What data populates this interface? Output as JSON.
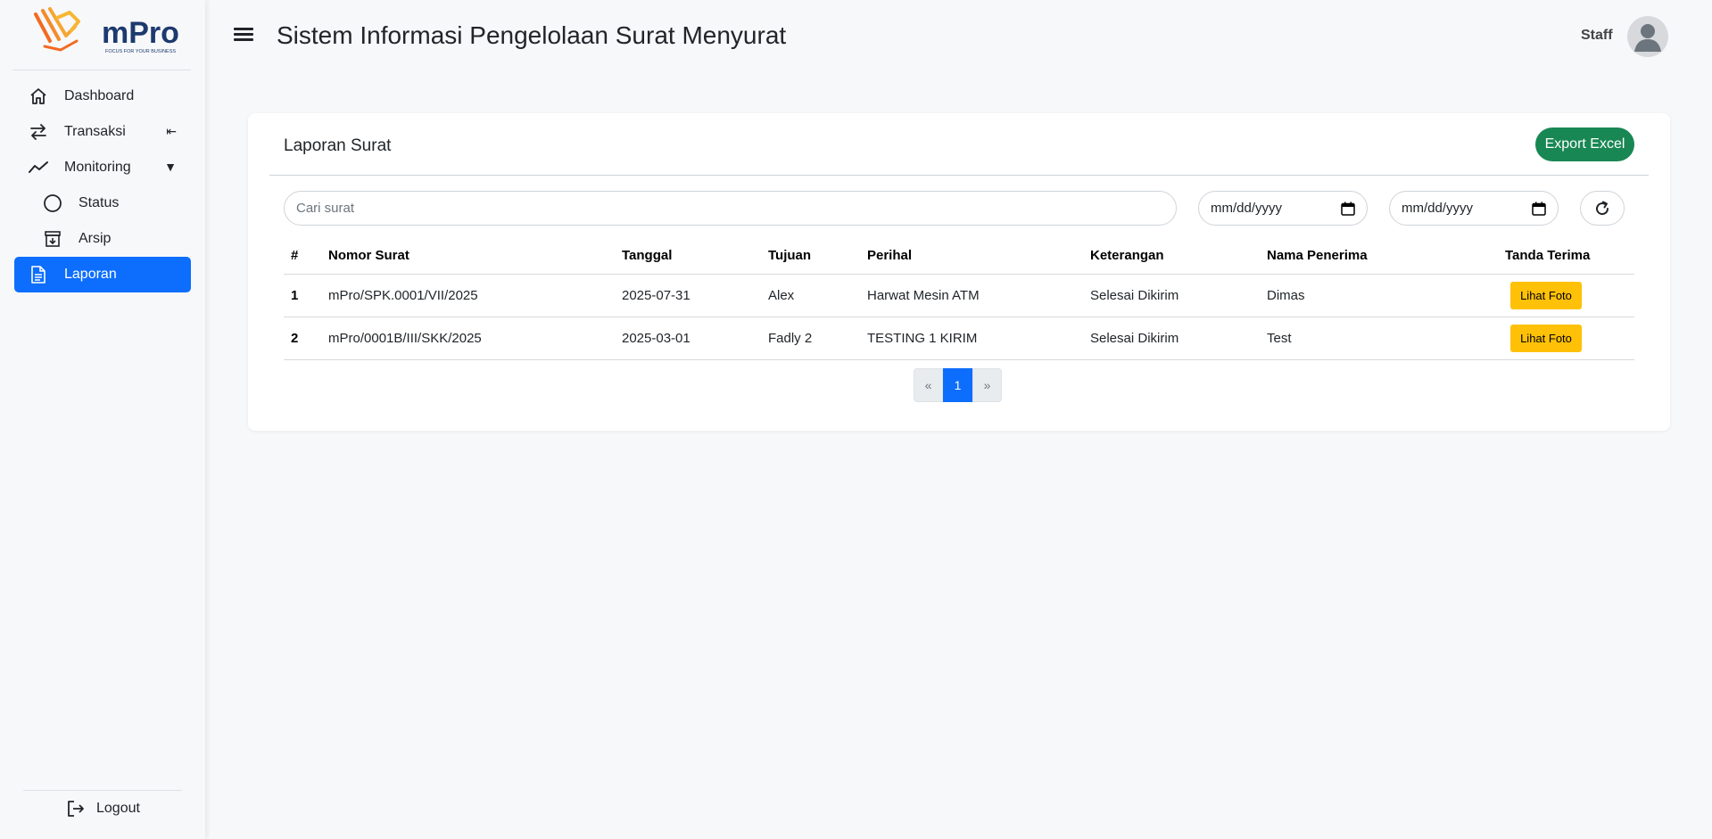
{
  "brand": {
    "name": "mPro",
    "tagline": "FOCUS FOR YOUR BUSINESS"
  },
  "sidebar": {
    "items": [
      {
        "label": "Dashboard",
        "icon": "home-icon"
      },
      {
        "label": "Transaksi",
        "icon": "transfer-icon",
        "caret": "⇤"
      },
      {
        "label": "Monitoring",
        "icon": "trend-line-icon",
        "caret": "▼"
      },
      {
        "label": "Status",
        "icon": "circle-icon"
      },
      {
        "label": "Arsip",
        "icon": "archive-icon"
      },
      {
        "label": "Laporan",
        "icon": "document-icon",
        "active": true
      }
    ],
    "logout_label": "Logout"
  },
  "header": {
    "title": "Sistem Informasi Pengelolaan Surat Menyurat",
    "user_role": "Staff"
  },
  "report": {
    "title": "Laporan Surat",
    "export_label": "Export Excel",
    "search_placeholder": "Cari surat",
    "date_from_placeholder": "mm/dd/yyyy",
    "date_to_placeholder": "mm/dd/yyyy",
    "columns": [
      "#",
      "Nomor Surat",
      "Tanggal",
      "Tujuan",
      "Perihal",
      "Keterangan",
      "Nama Penerima",
      "Tanda Terima"
    ],
    "rows": [
      {
        "no": "1",
        "nomor": "mPro/SPK.0001/VII/2025",
        "tanggal": "2025-07-31",
        "tujuan": "Alex",
        "perihal": "Harwat Mesin ATM",
        "keterangan": "Selesai Dikirim",
        "penerima": "Dimas",
        "action": "Lihat Foto"
      },
      {
        "no": "2",
        "nomor": "mPro/0001B/III/SKK/2025",
        "tanggal": "2025-03-01",
        "tujuan": "Fadly 2",
        "perihal": "TESTING 1 KIRIM",
        "keterangan": "Selesai Dikirim",
        "penerima": "Test",
        "action": "Lihat Foto"
      }
    ],
    "pagination": {
      "prev": "«",
      "current": "1",
      "next": "»"
    }
  },
  "colors": {
    "primary": "#0d6efd",
    "success": "#198754",
    "warning": "#ffc107",
    "brand_orange": "#f26b21",
    "brand_navy": "#1d3a6e"
  }
}
